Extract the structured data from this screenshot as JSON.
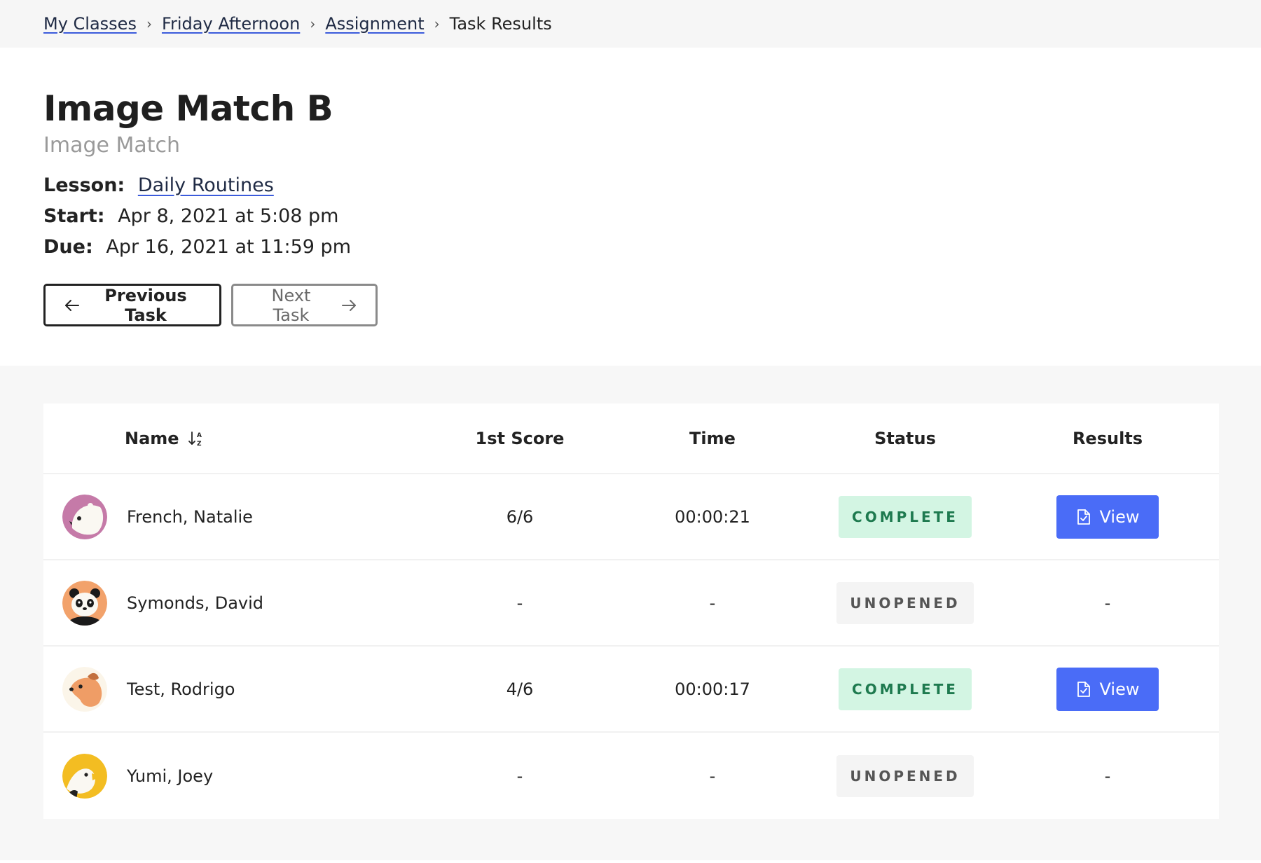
{
  "breadcrumb": {
    "items": [
      {
        "label": "My Classes"
      },
      {
        "label": "Friday Afternoon"
      },
      {
        "label": "Assignment"
      }
    ],
    "current": "Task Results",
    "separator": "›"
  },
  "task": {
    "title": "Image Match B",
    "type": "Image Match",
    "lesson_label": "Lesson:",
    "lesson_value": "Daily Routines",
    "start_label": "Start:",
    "start_value": "Apr 8, 2021 at 5:08 pm",
    "due_label": "Due:",
    "due_value": "Apr 16, 2021 at 11:59 pm"
  },
  "nav": {
    "previous_label": "Previous Task",
    "next_label": "Next Task"
  },
  "table": {
    "columns": [
      "Name",
      "1st Score",
      "Time",
      "Status",
      "Results"
    ],
    "view_label": "View",
    "rows": [
      {
        "name": "French, Natalie",
        "score": "6/6",
        "time": "00:00:21",
        "status": "COMPLETE",
        "results": "",
        "avatar": "polar-bear-avatar"
      },
      {
        "name": "Symonds, David",
        "score": "-",
        "time": "-",
        "status": "UNOPENED",
        "results": "-",
        "avatar": "panda-avatar"
      },
      {
        "name": "Test, Rodrigo",
        "score": "4/6",
        "time": "00:00:17",
        "status": "COMPLETE",
        "results": "",
        "avatar": "dog-avatar"
      },
      {
        "name": "Yumi, Joey",
        "score": "-",
        "time": "-",
        "status": "UNOPENED",
        "results": "-",
        "avatar": "bird-avatar"
      }
    ]
  },
  "colors": {
    "accent": "#4a6cf7",
    "complete_bg": "#d3f5e3",
    "complete_text": "#1e7a4f",
    "unopened_bg": "#f4f4f4"
  }
}
